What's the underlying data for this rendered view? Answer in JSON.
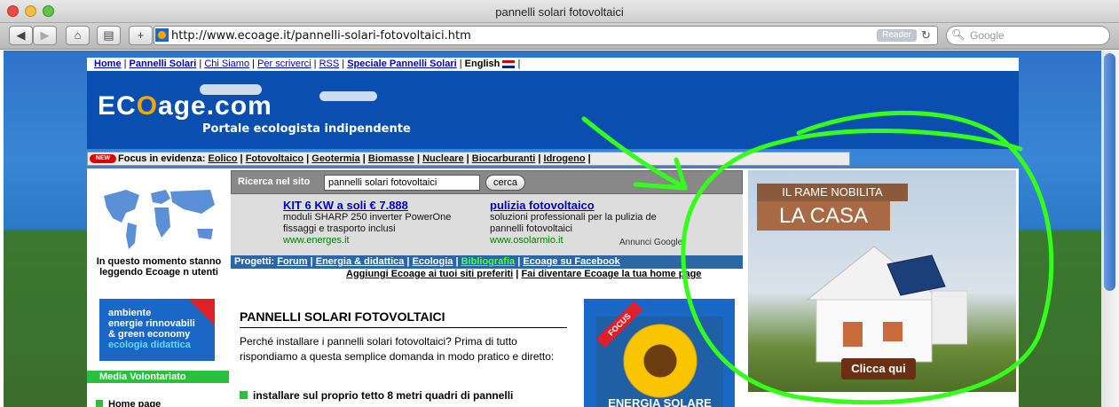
{
  "window": {
    "title": "pannelli solari fotovoltaici"
  },
  "toolbar": {
    "url": "http://www.ecoage.it/pannelli-solari-fotovoltaici.htm",
    "reader": "Reader",
    "search_placeholder": "Google",
    "new_tab": "+"
  },
  "nav": {
    "home": "Home",
    "pannelli": "Pannelli Solari",
    "chi_siamo": "Chi Siamo",
    "per_scriverci": "Per scriverci",
    "rss": "RSS",
    "speciale": "Speciale Pannelli Solari",
    "english": "English"
  },
  "header": {
    "logo_pre": "EC",
    "logo_o": "O",
    "logo_post": "age.com",
    "tagline": "Portale ecologista indipendente"
  },
  "focus": {
    "badge": "NEW",
    "label": "Focus in evidenza:",
    "items": [
      "Eolico",
      "Fotovoltaico",
      "Geotermia",
      "Biomasse",
      "Nucleare",
      "Biocarburanti",
      "Idrogeno"
    ]
  },
  "left": {
    "readers": "In questo momento stanno leggendo Ecoage n utenti",
    "banner_line1": "ambiente",
    "banner_line2": "energie rinnovabili",
    "banner_line3": "& green economy",
    "banner_line4": "ecologia didattica",
    "media_heading": "Media Volontariato",
    "home_page": "Home page"
  },
  "site_search": {
    "label": "Ricerca nel sito",
    "value": "pannelli solari fotovoltaici",
    "button": "cerca"
  },
  "ads": [
    {
      "title": "KIT 6 KW a soli € 7.888",
      "desc1": "moduli SHARP 250 inverter PowerOne",
      "desc2": "fissaggi e trasporto inclusi",
      "url": "www.energes.it"
    },
    {
      "title": "pulizia fotovoltaico",
      "desc1": "soluzioni professionali per la pulizia de",
      "desc2": "pannelli fotovoltaici",
      "url": "www.osolarmio.it"
    }
  ],
  "annunci": "Annunci Google",
  "progetti": {
    "label": "Progetti:",
    "items": [
      "Forum",
      "Energia & didattica",
      "Ecologia",
      "Bibliografia",
      "Ecoage su Facebook"
    ]
  },
  "links": {
    "aggiungi": "Aggiungi Ecoage ai tuoi siti preferiti",
    "home": "Fai diventare Ecoage la tua home page"
  },
  "article": {
    "title": "PANNELLI SOLARI FOTOVOLTAICI",
    "body": "Perché installare i pannelli solari fotovoltaici? Prima di tutto rispondiamo a questa semplice domanda in modo pratico e diretto:",
    "bullet": "installare sul proprio tetto 8 metri quadri di pannelli"
  },
  "focus_box": {
    "ribbon": "FOCUS",
    "caption": "ENERGIA SOLARE"
  },
  "big_ad": {
    "line1": "IL RAME NOBILITA",
    "line2": "LA CASA",
    "button": "Clicca qui"
  },
  "colors": {
    "annotation": "#33ff1a",
    "accent": "#0a4fb0"
  }
}
